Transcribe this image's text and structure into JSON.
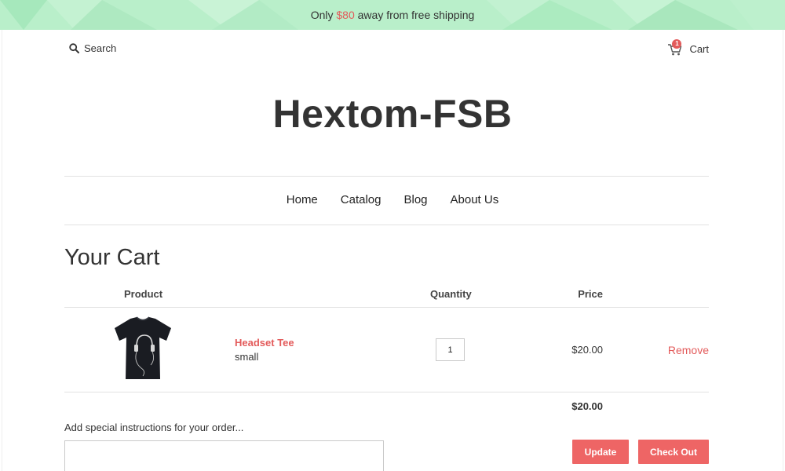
{
  "announcement": {
    "prefix": "Only ",
    "amount": "$80",
    "suffix": " away from free shipping"
  },
  "header": {
    "search_label": "Search",
    "cart_label": "Cart",
    "cart_count": "1",
    "logo": "Hextom-FSB"
  },
  "nav": {
    "items": [
      {
        "label": "Home"
      },
      {
        "label": "Catalog"
      },
      {
        "label": "Blog"
      },
      {
        "label": "About Us"
      }
    ]
  },
  "cart": {
    "title": "Your Cart",
    "columns": {
      "product": "Product",
      "quantity": "Quantity",
      "price": "Price"
    },
    "items": [
      {
        "name": "Headset Tee",
        "variant": "small",
        "quantity": "1",
        "price": "$20.00",
        "remove_label": "Remove",
        "image_icon": "tshirt-image"
      }
    ],
    "subtotal": "$20.00",
    "instructions_label": "Add special instructions for your order...",
    "update_label": "Update",
    "checkout_label": "Check Out"
  },
  "colors": {
    "accent": "#e35b5b",
    "button": "#ee6565",
    "announcement_bg": "#b8eec8"
  }
}
